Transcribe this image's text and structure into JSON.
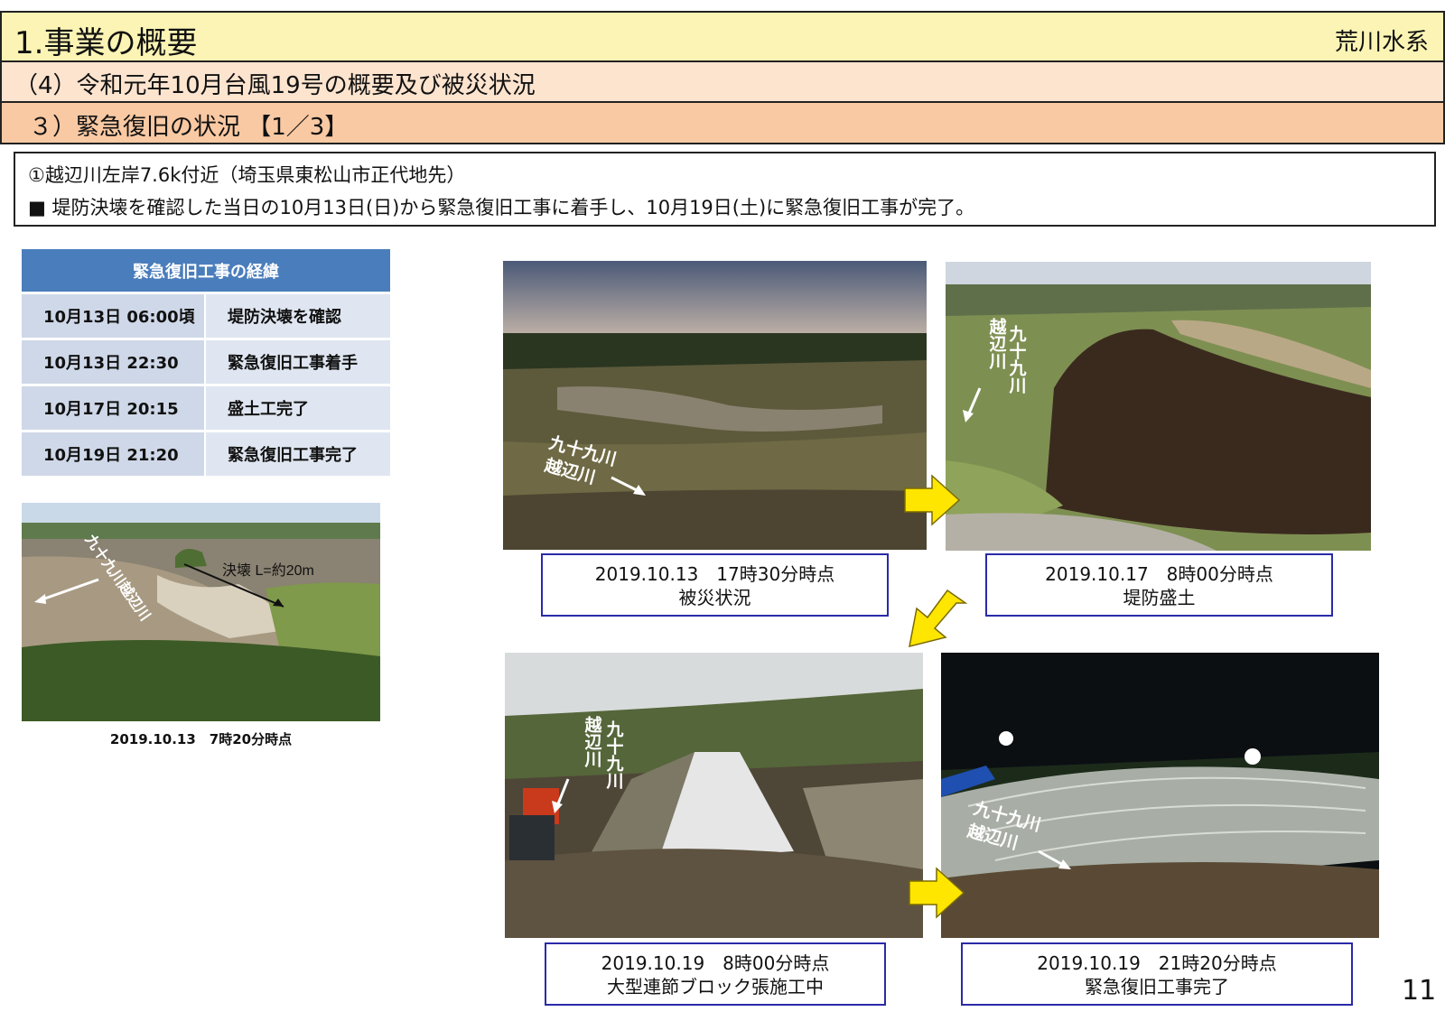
{
  "header": {
    "title": "1.事業の概要",
    "right": "荒川水系",
    "section": "（4）令和元年10月台風19号の概要及び被災状況",
    "subsection": "３）緊急復旧の状況 【1／3】"
  },
  "info": {
    "location": "①越辺川左岸7.6k付近（埼玉県東松山市正代地先）",
    "summary": "■ 堤防決壊を確認した当日の10月13日(日)から緊急復旧工事に着手し、10月19日(土)に緊急復旧工事が完了。"
  },
  "timeline": {
    "header": "緊急復旧工事の経緯",
    "rows": [
      {
        "time": "10月13日  06:00頃",
        "event": "堤防決壊を確認"
      },
      {
        "time": "10月13日  22:30",
        "event": "緊急復旧工事着手"
      },
      {
        "time": "10月17日  20:15",
        "event": "盛土工完了"
      },
      {
        "time": "10月19日  21:20",
        "event": "緊急復旧工事完了"
      }
    ]
  },
  "left_photo": {
    "caption": "2019.10.13　7時20分時点",
    "label_break": "決壊 L=約20m",
    "river_label": "九十九川越辺川"
  },
  "photos": [
    {
      "date": "2019.10.13　17時30分時点",
      "desc": "被災状況",
      "river_label": [
        "九十九川",
        "越辺川"
      ]
    },
    {
      "date": "2019.10.17　8時00分時点",
      "desc": "堤防盛土",
      "river_label": [
        "九十九川",
        "越辺川"
      ]
    },
    {
      "date": "2019.10.19　8時00分時点",
      "desc": "大型連節ブロック張施工中",
      "river_label": [
        "九十九川",
        "越辺川"
      ]
    },
    {
      "date": "2019.10.19　21時20分時点",
      "desc": "緊急復旧工事完了",
      "river_label": [
        "九十九川",
        "越辺川"
      ]
    }
  ],
  "page_number": "11",
  "colors": {
    "title_bar": "#fbf4b4",
    "section_bar": "#fde4cf",
    "subsection_bar": "#f9c9a3",
    "table_header": "#4a7dbb",
    "arrow": "#ffe600",
    "caption_border": "#2a2aa8"
  }
}
